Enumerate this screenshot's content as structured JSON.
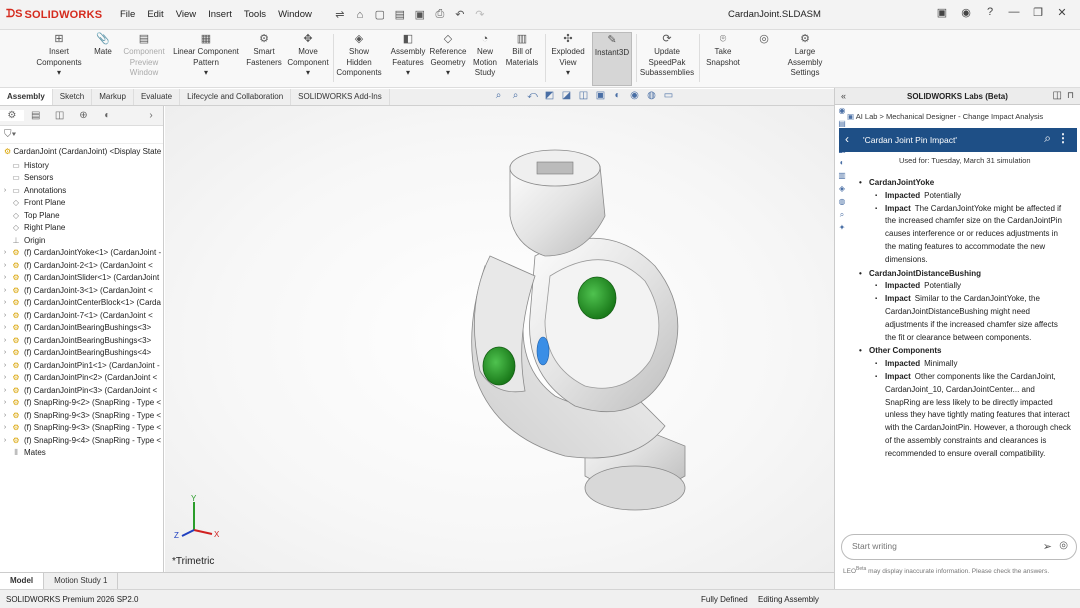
{
  "app": {
    "logo_text": "SOLIDWORKS",
    "document_title": "CardanJoint.SLDASM"
  },
  "menu": [
    "File",
    "Edit",
    "View",
    "Insert",
    "Tools",
    "Window"
  ],
  "ribbon": {
    "insert_components": "Insert Components",
    "mate": "Mate",
    "component_preview_window": "Component Preview Window",
    "linear_component_pattern": "Linear Component Pattern",
    "smart_fasteners": "Smart Fasteners",
    "move_component": "Move Component",
    "show_hidden_components": "Show Hidden Components",
    "assembly_features": "Assembly Features",
    "reference_geometry": "Reference Geometry",
    "new_motion_study": "New Motion Study",
    "bill_of_materials": "Bill of Materials",
    "exploded_view": "Exploded View",
    "instant3d": "Instant3D",
    "update_speedpak": "Update SpeedPak Subassemblies",
    "take_snapshot": "Take Snapshot",
    "large_assembly_settings": "Large Assembly Settings"
  },
  "tabs": [
    "Assembly",
    "Sketch",
    "Markup",
    "Evaluate",
    "Lifecycle and Collaboration",
    "SOLIDWORKS Add-Ins"
  ],
  "tree": {
    "root": "CardanJoint (CardanJoint) <Display State",
    "items": [
      {
        "label": "History",
        "type": "folder",
        "arrow": false
      },
      {
        "label": "Sensors",
        "type": "folder",
        "arrow": false
      },
      {
        "label": "Annotations",
        "type": "folder",
        "arrow": true
      },
      {
        "label": "Front Plane",
        "type": "plane",
        "arrow": false
      },
      {
        "label": "Top Plane",
        "type": "plane",
        "arrow": false
      },
      {
        "label": "Right Plane",
        "type": "plane",
        "arrow": false
      },
      {
        "label": "Origin",
        "type": "origin",
        "arrow": false
      },
      {
        "label": "(f) CardanJointYoke<1> (CardanJoint -",
        "type": "part",
        "arrow": true
      },
      {
        "label": "(f) CardanJoint-2<1> (CardanJoint <",
        "type": "part",
        "arrow": true
      },
      {
        "label": "(f) CardanJointSlider<1> (CardanJoint",
        "type": "part",
        "arrow": true
      },
      {
        "label": "(f) CardanJoint-3<1> (CardanJoint <",
        "type": "part",
        "arrow": true
      },
      {
        "label": "(f) CardanJointCenterBlock<1> (Carda",
        "type": "part",
        "arrow": true
      },
      {
        "label": "(f) CardanJoint-7<1> (CardanJoint <",
        "type": "part",
        "arrow": true
      },
      {
        "label": "(f) CardanJointBearingBushings<3>",
        "type": "part",
        "arrow": true
      },
      {
        "label": "(f) CardanJointBearingBushings<3>",
        "type": "part",
        "arrow": true
      },
      {
        "label": "(f) CardanJointBearingBushings<4>",
        "type": "part",
        "arrow": true
      },
      {
        "label": "(f) CardanJointPin1<1> (CardanJoint -",
        "type": "part",
        "arrow": true
      },
      {
        "label": "(f) CardanJointPin<2> (CardanJoint <",
        "type": "part",
        "arrow": true
      },
      {
        "label": "(f) CardanJointPin<3> (CardanJoint <",
        "type": "part",
        "arrow": true
      },
      {
        "label": "(f) SnapRing-9<2> (SnapRing - Type <",
        "type": "part",
        "arrow": true
      },
      {
        "label": "(f) SnapRing-9<3> (SnapRing - Type <",
        "type": "part",
        "arrow": true
      },
      {
        "label": "(f) SnapRing-9<3> (SnapRing - Type <",
        "type": "part",
        "arrow": true
      },
      {
        "label": "(f) SnapRing-9<4> (SnapRing - Type <",
        "type": "part",
        "arrow": true
      },
      {
        "label": "Mates",
        "type": "mates",
        "arrow": false
      }
    ]
  },
  "viewport": {
    "view_label": "*Trimetric",
    "axis_x": "X",
    "axis_y": "Y",
    "axis_z": "Z"
  },
  "bottom_tabs": [
    "Model",
    "Motion Study 1"
  ],
  "status": {
    "edition": "SOLIDWORKS Premium 2026 SP2.0",
    "defined": "Fully Defined",
    "mode": "Editing Assembly"
  },
  "labs": {
    "title": "SOLIDWORKS Labs (Beta)",
    "breadcrumb": "AI Lab > Mechanical Designer - Change Impact Analysis",
    "query": "'Cardan Joint Pin Impact'",
    "used_for": "Used for:  Tuesday, March 31  simulation",
    "sections": [
      {
        "title": "CardanJointYoke",
        "impacted": "Potentially",
        "impact": "The CardanJointYoke might be affected if the increased chamfer size on the CardanJointPin causes interference or or reduces adjustments in the mating features to accommodate the new dimensions."
      },
      {
        "title": "CardanJointDistanceBushing",
        "impacted": "Potentially",
        "impact": "Similar to the CardanJointYoke, the CardanJointDistanceBushing might need adjustments if the increased chamfer size affects the fit or clearance between components."
      },
      {
        "title": "Other Components",
        "impacted": "Minimally",
        "impact": "Other components like the CardanJoint, CardanJoint_10, CardanJointCenter... and SnapRing are less likely to be directly impacted unless they have tightly mating features that interact with the CardanJointPin. However, a thorough check of the assembly constraints and clearances is recommended to ensure overall compatibility."
      }
    ],
    "label_impacted": "Impacted",
    "label_impact": "Impact",
    "input_placeholder": "Start writing",
    "disclaimer_brand": "LEO",
    "disclaimer_beta": "Beta",
    "disclaimer": "may display inaccurate information. Please check the answers."
  }
}
